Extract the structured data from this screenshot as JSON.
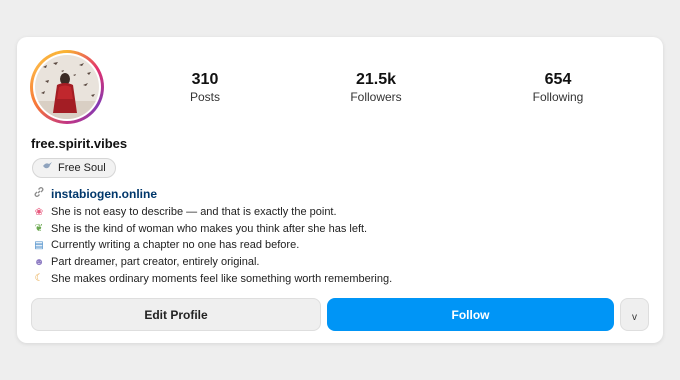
{
  "profile": {
    "username": "free.spirit.vibes",
    "avatar_icon": "profile-photo-woman-red-dress"
  },
  "stats": [
    {
      "value": "310",
      "label": "Posts"
    },
    {
      "value": "21.5k",
      "label": "Followers"
    },
    {
      "value": "654",
      "label": "Following"
    }
  ],
  "tag": {
    "icon": "dove-icon",
    "label": "Free Soul"
  },
  "link": {
    "icon": "link-icon",
    "text": "instabiogen.online"
  },
  "bio": [
    {
      "icon": "flower-icon",
      "glyph": "❀",
      "color": "#e8577c",
      "text": "She is not easy to describe — and that is exactly the point."
    },
    {
      "icon": "herb-icon",
      "glyph": "❦",
      "color": "#6aa84f",
      "text": "She is the kind of woman who makes you think after she has left."
    },
    {
      "icon": "book-icon",
      "glyph": "▤",
      "color": "#3d85c6",
      "text": "Currently writing a chapter no one has read before."
    },
    {
      "icon": "theater-masks-icon",
      "glyph": "☻",
      "color": "#b4a7d6",
      "text": "Part dreamer, part creator, entirely original."
    },
    {
      "icon": "crescent-moon-icon",
      "glyph": "☾",
      "color": "#e6a23c",
      "text": "She makes ordinary moments feel like something worth remembering."
    }
  ],
  "buttons": {
    "edit_profile": "Edit Profile",
    "follow": "Follow",
    "more": "v"
  },
  "colors": {
    "follow_button": "#0095f6",
    "link_text": "#00376b"
  }
}
